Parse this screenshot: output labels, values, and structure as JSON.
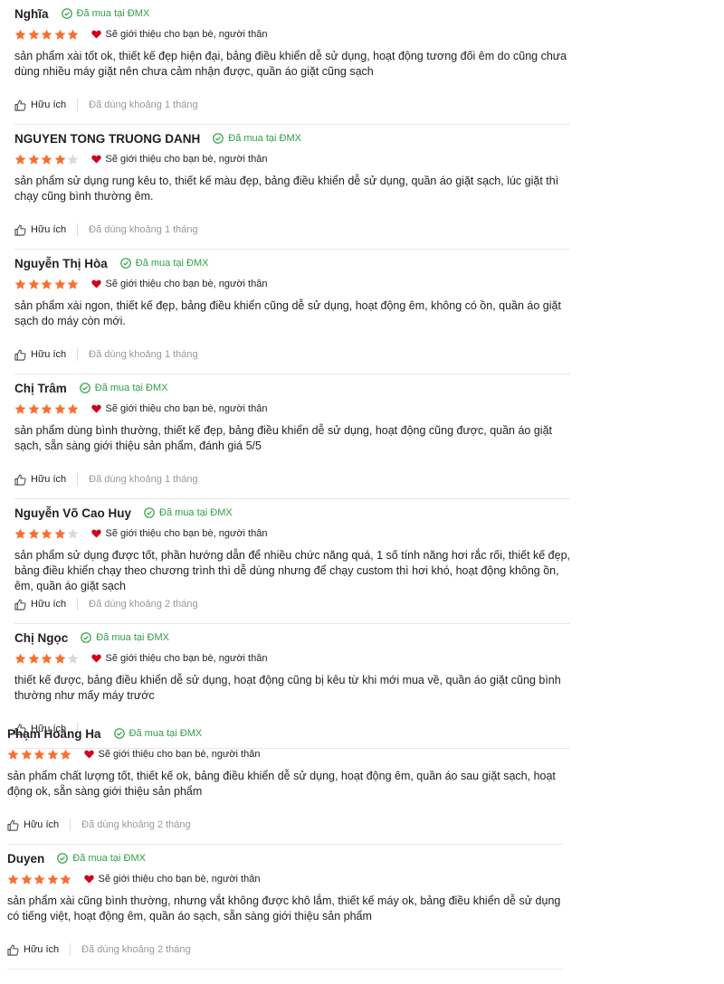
{
  "colors": {
    "star": "#fb6e2e",
    "star_empty": "#d9d9d9",
    "bought_green": "#2f9e44",
    "heart": "#d0021b"
  },
  "labels": {
    "bought": "Đã mua tại ĐMX",
    "recommend": "Sẽ giới thiệu cho bạn bè, người thân",
    "helpful": "Hữu ích"
  },
  "reviews": [
    {
      "name": "Nghĩa",
      "stars": 5,
      "text": "sản phẩm xài tốt ok, thiết kế đẹp hiện đại, bảng điều khiển dễ sử dụng, hoạt động tương đối êm do cũng chưa dùng nhiều máy giặt nên chưa cảm nhận được, quần áo giặt cũng sạch",
      "used": "Đã dùng khoảng 1 tháng"
    },
    {
      "name": "NGUYEN TONG TRUONG DANH",
      "stars": 4,
      "text": "sản phẩm sử dụng rung kêu to, thiết kế màu đẹp, bảng điều khiển dễ sử dụng, quần áo giặt sạch, lúc giặt thì chạy cũng bình thường êm.",
      "used": "Đã dùng khoảng 1 tháng"
    },
    {
      "name": "Nguyễn Thị Hòa",
      "stars": 5,
      "text": "sản phẩm xài ngon, thiết kế đẹp, bảng điều khiển cũng dễ sử dụng, hoạt động êm, không có ồn, quần áo giặt sạch do máy còn mới.",
      "used": "Đã dùng khoảng 1 tháng"
    },
    {
      "name": "Chị Trâm",
      "stars": 5,
      "text": "sản phẩm dùng bình thường, thiết kế đẹp, bảng điều khiển dễ sử dụng, hoạt động cũng được, quần áo giặt sạch, sẵn sàng giới thiệu sản phẩm, đánh giá 5/5",
      "used": "Đã dùng khoảng 1 tháng"
    },
    {
      "name": "Nguyễn Võ Cao Huy",
      "stars": 4,
      "text": "sản phẩm sử dụng được tốt, phần hướng dẫn để nhiều chức năng quá, 1 số tính năng hơi rắc rối, thiết kế đẹp, bảng điều khiển chạy theo chương trình thì dễ dùng nhưng để chạy custom thì hơi khó, hoạt động không ồn, êm, quần áo giặt sạch",
      "used": "Đã dùng khoảng 2 tháng"
    },
    {
      "name": "Chị Ngọc",
      "stars": 4,
      "text": "thiết kế được, bảng điều khiển dễ sử dụng, hoạt động cũng bị kêu từ khi mới mua về, quần áo giặt cũng bình thường như mấy máy trước",
      "used": ""
    },
    {
      "name": "Phạm Hoàng Ha",
      "stars": 5,
      "text": "sản phẩm chất lượng tốt, thiết kế ok, bảng điều khiển dễ sử dụng, hoạt động êm, quần áo sau giặt sạch, hoạt động ok, sẵn sàng giới thiệu sản phẩm",
      "used": "Đã dùng khoảng 2 tháng"
    },
    {
      "name": "Duyen",
      "stars": 5,
      "text": "sản phẩm xài cũng bình thường, nhưng vắt không được khô lắm, thiết kế máy ok, bảng điều khiển dễ sử dụng có tiếng việt, hoạt động êm, quần áo sạch, sẵn sàng giới thiệu sản phẩm",
      "used": "Đã dùng khoảng 2 tháng"
    }
  ]
}
